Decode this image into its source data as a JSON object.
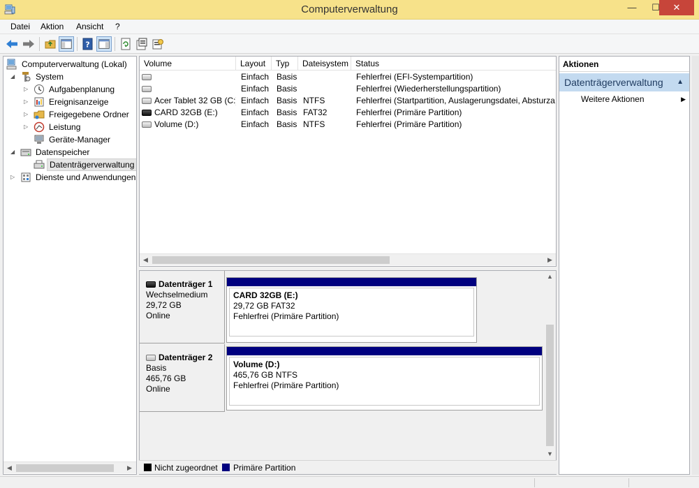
{
  "window": {
    "title": "Computerverwaltung"
  },
  "menu": [
    "Datei",
    "Aktion",
    "Ansicht",
    "?"
  ],
  "tree": {
    "items": [
      {
        "label": "Computerverwaltung (Lokal)",
        "level": 0,
        "expander": ""
      },
      {
        "label": "System",
        "level": 1,
        "expander": "◢"
      },
      {
        "label": "Aufgabenplanung",
        "level": 2,
        "expander": "▷"
      },
      {
        "label": "Ereignisanzeige",
        "level": 2,
        "expander": "▷"
      },
      {
        "label": "Freigegebene Ordner",
        "level": 2,
        "expander": "▷"
      },
      {
        "label": "Leistung",
        "level": 2,
        "expander": "▷"
      },
      {
        "label": "Geräte-Manager",
        "level": 2,
        "expander": ""
      },
      {
        "label": "Datenspeicher",
        "level": 1,
        "expander": "◢"
      },
      {
        "label": "Datenträgerverwaltung",
        "level": 2,
        "expander": ""
      },
      {
        "label": "Dienste und Anwendungen",
        "level": 1,
        "expander": "▷"
      }
    ]
  },
  "volume_list": {
    "columns": [
      "Volume",
      "Layout",
      "Typ",
      "Dateisystem",
      "Status"
    ],
    "rows": [
      {
        "volume": "",
        "layout": "Einfach",
        "typ": "Basis",
        "fs": "",
        "status": "Fehlerfrei (EFI-Systempartition)",
        "icon": "drive-icon"
      },
      {
        "volume": "",
        "layout": "Einfach",
        "typ": "Basis",
        "fs": "",
        "status": "Fehlerfrei (Wiederherstellungspartition)",
        "icon": "drive-icon"
      },
      {
        "volume": "Acer Tablet 32 GB (C:)",
        "layout": "Einfach",
        "typ": "Basis",
        "fs": "NTFS",
        "status": "Fehlerfrei (Startpartition, Auslagerungsdatei, Absturzab",
        "icon": "drive-icon"
      },
      {
        "volume": "CARD 32GB (E:)",
        "layout": "Einfach",
        "typ": "Basis",
        "fs": "FAT32",
        "status": "Fehlerfrei (Primäre Partition)",
        "icon": "removable-drive-icon"
      },
      {
        "volume": "Volume (D:)",
        "layout": "Einfach",
        "typ": "Basis",
        "fs": "NTFS",
        "status": "Fehlerfrei (Primäre Partition)",
        "icon": "drive-icon"
      }
    ]
  },
  "disks": [
    {
      "name": "Datenträger 1",
      "type": "Wechselmedium",
      "size": "29,72 GB",
      "state": "Online",
      "partition": {
        "name": "CARD 32GB  (E:)",
        "detail": "29,72 GB FAT32",
        "status": "Fehlerfrei (Primäre Partition)"
      }
    },
    {
      "name": "Datenträger 2",
      "type": "Basis",
      "size": "465,76 GB",
      "state": "Online",
      "partition": {
        "name": "Volume  (D:)",
        "detail": "465,76 GB NTFS",
        "status": "Fehlerfrei (Primäre Partition)"
      }
    }
  ],
  "legend": [
    {
      "label": "Nicht zugeordnet",
      "color": "#000000"
    },
    {
      "label": "Primäre Partition",
      "color": "#00007f"
    }
  ],
  "actions": {
    "header": "Aktionen",
    "section": "Datenträgerverwaltung",
    "items": [
      "Weitere Aktionen"
    ]
  }
}
